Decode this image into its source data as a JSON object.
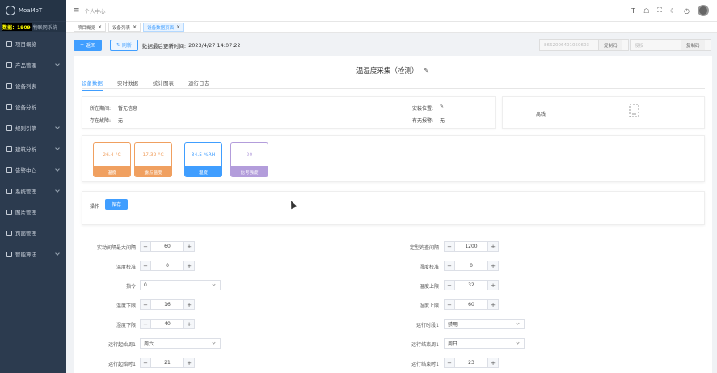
{
  "sidebar": {
    "logo_text": "MoaMoT",
    "system_badge": "数据：1909",
    "system_name": "物联网系统",
    "items": [
      {
        "label": "项目概览",
        "icon": "dashboard-icon",
        "has_arrow": false
      },
      {
        "label": "产品管理",
        "icon": "product-icon",
        "has_arrow": true
      },
      {
        "label": "设备列表",
        "icon": "device-list-icon",
        "has_arrow": false
      },
      {
        "label": "设备分析",
        "icon": "device-analysis-icon",
        "has_arrow": false
      },
      {
        "label": "规则引擎",
        "icon": "rule-engine-icon",
        "has_arrow": true
      },
      {
        "label": "建筑分析",
        "icon": "building-icon",
        "has_arrow": true
      },
      {
        "label": "告警中心",
        "icon": "alarm-icon",
        "has_arrow": true
      },
      {
        "label": "系统管理",
        "icon": "settings-icon",
        "has_arrow": true
      },
      {
        "label": "图片管理",
        "icon": "image-icon",
        "has_arrow": false
      },
      {
        "label": "页面管理",
        "icon": "page-icon",
        "has_arrow": false
      },
      {
        "label": "智能算法",
        "icon": "chart-icon",
        "has_arrow": true
      }
    ]
  },
  "topbar": {
    "breadcrumb": "个人中心",
    "icons": [
      "font-size-icon",
      "github-icon",
      "fullscreen-icon",
      "theme-icon",
      "notification-icon",
      "avatar"
    ]
  },
  "tags": [
    {
      "label": "项目概览",
      "active": false
    },
    {
      "label": "设备列表",
      "active": false
    },
    {
      "label": "设备数据页面",
      "active": true
    }
  ],
  "actionbar": {
    "back_label": "返回",
    "refresh_label": "刷新",
    "update_label": "数据最后更新时间:",
    "update_time": "2023/4/27 14:07:22",
    "device_id": "8662006401050603",
    "copy1_label": "复制码",
    "field2_placeholder": "授权",
    "copy2_label": "复制码"
  },
  "device": {
    "title": "温湿度采集（检测）",
    "tabs": [
      "设备数据",
      "实时数据",
      "统计图表",
      "运行日志"
    ],
    "info": {
      "period_label": "所在期间:",
      "period_value": "暂无信息",
      "fault_label": "存在故障:",
      "fault_value": "无",
      "location_label": "安装位置:",
      "alarm_label": "有无报警:",
      "alarm_value": "无",
      "status": "离线"
    },
    "gauges": [
      {
        "value": "26.4 °C",
        "label": "温度",
        "color": "#f0a060"
      },
      {
        "value": "17.32 °C",
        "label": "露点温度",
        "color": "#f0a060"
      },
      {
        "value": "34.5 %RH",
        "label": "湿度",
        "color": "#409eff"
      },
      {
        "value": "20",
        "label": "信号强度",
        "color": "#b39ddb"
      }
    ]
  },
  "operation": {
    "label": "操作",
    "save_label": "保存"
  },
  "form": {
    "left": [
      {
        "label": "实动间隔最大间隔",
        "type": "stepper",
        "value": "60"
      },
      {
        "label": "温度校准",
        "type": "stepper",
        "value": "0"
      },
      {
        "label": "指令",
        "type": "select",
        "value": "0"
      },
      {
        "label": "温度下限",
        "type": "stepper",
        "value": "16"
      },
      {
        "label": "湿度下限",
        "type": "stepper",
        "value": "40"
      },
      {
        "label": "运行起始周1",
        "type": "select",
        "value": "周六"
      },
      {
        "label": "运行起始时1",
        "type": "stepper",
        "value": "21"
      }
    ],
    "right": [
      {
        "label": "定型询查间隔",
        "type": "stepper",
        "value": "1200"
      },
      {
        "label": "湿度校准",
        "type": "stepper",
        "value": "0"
      },
      {
        "label": "温度上限",
        "type": "stepper",
        "value": "32"
      },
      {
        "label": "湿度上限",
        "type": "stepper",
        "value": "60"
      },
      {
        "label": "运行时段1",
        "type": "select",
        "value": "禁用"
      },
      {
        "label": "运行结束周1",
        "type": "select",
        "value": "周日"
      },
      {
        "label": "运行结束时1",
        "type": "stepper",
        "value": "23"
      }
    ]
  }
}
